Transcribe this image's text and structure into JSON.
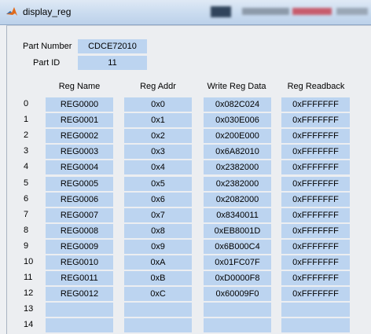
{
  "window": {
    "title": "display_reg",
    "icon": "matlab-icon"
  },
  "part": {
    "number_label": "Part Number",
    "number_value": "CDCE72010",
    "id_label": "Part ID",
    "id_value": "11"
  },
  "columns": [
    "Reg Name",
    "Reg Addr",
    "Write Reg Data",
    "Reg Readback"
  ],
  "rows": [
    {
      "idx": "0",
      "name": "REG0000",
      "addr": "0x0",
      "write": "0x082C024",
      "read": "0xFFFFFFF"
    },
    {
      "idx": "1",
      "name": "REG0001",
      "addr": "0x1",
      "write": "0x030E006",
      "read": "0xFFFFFFF"
    },
    {
      "idx": "2",
      "name": "REG0002",
      "addr": "0x2",
      "write": "0x200E000",
      "read": "0xFFFFFFF"
    },
    {
      "idx": "3",
      "name": "REG0003",
      "addr": "0x3",
      "write": "0x6A82010",
      "read": "0xFFFFFFF"
    },
    {
      "idx": "4",
      "name": "REG0004",
      "addr": "0x4",
      "write": "0x2382000",
      "read": "0xFFFFFFF"
    },
    {
      "idx": "5",
      "name": "REG0005",
      "addr": "0x5",
      "write": "0x2382000",
      "read": "0xFFFFFFF"
    },
    {
      "idx": "6",
      "name": "REG0006",
      "addr": "0x6",
      "write": "0x2082000",
      "read": "0xFFFFFFF"
    },
    {
      "idx": "7",
      "name": "REG0007",
      "addr": "0x7",
      "write": "0x8340011",
      "read": "0xFFFFFFF"
    },
    {
      "idx": "8",
      "name": "REG0008",
      "addr": "0x8",
      "write": "0xEB8001D",
      "read": "0xFFFFFFF"
    },
    {
      "idx": "9",
      "name": "REG0009",
      "addr": "0x9",
      "write": "0x6B000C4",
      "read": "0xFFFFFFF"
    },
    {
      "idx": "10",
      "name": "REG0010",
      "addr": "0xA",
      "write": "0x01FC07F",
      "read": "0xFFFFFFF"
    },
    {
      "idx": "11",
      "name": "REG0011",
      "addr": "0xB",
      "write": "0xD0000F8",
      "read": "0xFFFFFFF"
    },
    {
      "idx": "12",
      "name": "REG0012",
      "addr": "0xC",
      "write": "0x60009F0",
      "read": "0xFFFFFFF"
    },
    {
      "idx": "13",
      "name": "",
      "addr": "",
      "write": "",
      "read": ""
    },
    {
      "idx": "14",
      "name": "",
      "addr": "",
      "write": "",
      "read": ""
    }
  ],
  "colors": {
    "field_bg": "#bcd4f0",
    "panel_bg": "#eceef1"
  }
}
